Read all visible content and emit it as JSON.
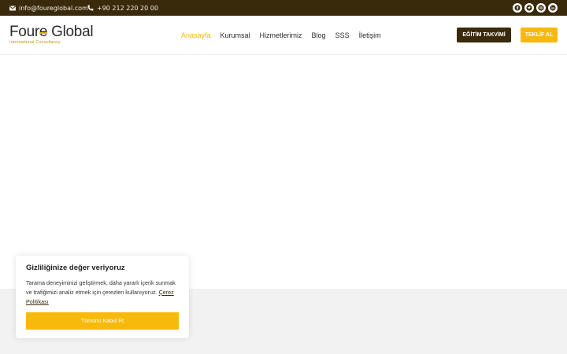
{
  "topbar": {
    "email": "info@foureglobal.com",
    "phone": "+90 212 220 20 00",
    "socials": [
      {
        "name": "facebook-icon"
      },
      {
        "name": "twitter-icon"
      },
      {
        "name": "instagram-icon"
      },
      {
        "name": "linkedin-icon"
      }
    ]
  },
  "logo": {
    "part1": "Four",
    "part2": "e",
    "part3": " Global",
    "subtitle": "International Consultancy"
  },
  "nav": {
    "items": [
      {
        "label": "Anasayfa",
        "active": true
      },
      {
        "label": "Kurumsal",
        "active": false
      },
      {
        "label": "Hizmetlerimiz",
        "active": false
      },
      {
        "label": "Blog",
        "active": false
      },
      {
        "label": "SSS",
        "active": false
      },
      {
        "label": "İletişim",
        "active": false
      }
    ]
  },
  "buttons": {
    "training_calendar": "EĞİTİM TAKVİMİ",
    "get_quote": "TEKLİF AL"
  },
  "cookie": {
    "title": "Gizliliğinize değer veriyoruz",
    "text": "Tarama deneyiminizi geliştirmek, daha yararlı içerik sunmak ve trafiğimizi analiz etmek için çerezleri kullanıyoruz.",
    "link": "Çerez Politikası",
    "accept": "Tümünü Kabul Et"
  },
  "colors": {
    "brand_dark": "#3a2a0c",
    "brand_yellow": "#f7b90c"
  }
}
